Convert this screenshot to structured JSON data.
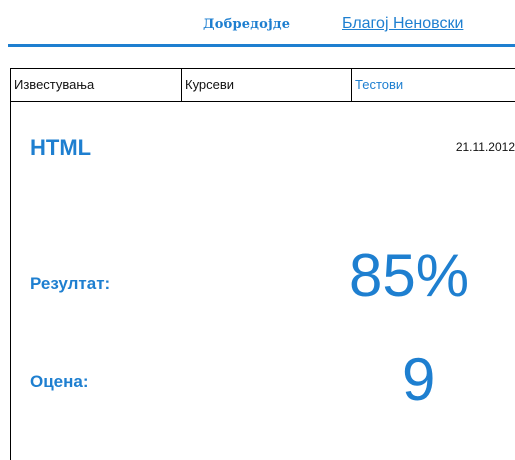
{
  "header": {
    "welcome": "Добредојде",
    "username": "Благој Неновски"
  },
  "tabs": [
    {
      "label": "Известувања",
      "active": false
    },
    {
      "label": "Курсеви",
      "active": false
    },
    {
      "label": "Тестови",
      "active": true
    }
  ],
  "test": {
    "name": "HTML",
    "date": "21.11.2012",
    "result_label": "Резултат:",
    "result_value": "85%",
    "grade_label": "Оцена:",
    "grade_value": "9"
  },
  "colors": {
    "accent": "#1e7fd0",
    "text": "#111111",
    "border": "#000000"
  }
}
